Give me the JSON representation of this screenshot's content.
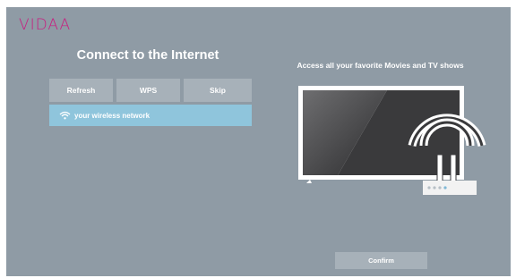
{
  "brand": {
    "logo": "VIDAA"
  },
  "left_panel": {
    "title": "Connect to the Internet",
    "buttons": {
      "refresh": "Refresh",
      "wps": "WPS",
      "skip": "Skip"
    },
    "network": {
      "label": "your wireless network",
      "icon": "wifi-icon"
    }
  },
  "right_panel": {
    "tagline": "Access all your favorite Movies and TV shows"
  },
  "footer": {
    "confirm": "Confirm"
  },
  "colors": {
    "background": "#8f9ba5",
    "button": "#a7b1b9",
    "selected": "#8fc5dc",
    "logo": "#c81e80"
  }
}
